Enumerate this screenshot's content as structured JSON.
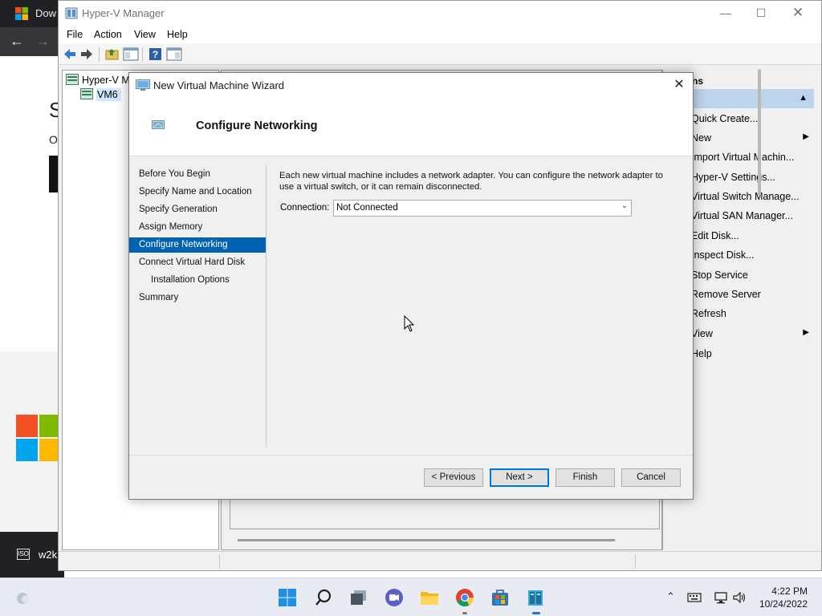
{
  "browser": {
    "tab_title": "Dow",
    "page_heading_fragment": "S",
    "page_text_fragment": "O",
    "download_item": "w2k",
    "download_icon_text": "ISO"
  },
  "hyperv": {
    "title": "Hyper-V Manager",
    "menu": [
      "File",
      "Action",
      "View",
      "Help"
    ],
    "tree_root": "Hyper-V M",
    "tree_child": "VM6",
    "actions_header": "ns",
    "actions": [
      {
        "label": "Quick Create...",
        "submenu": false
      },
      {
        "label": "New",
        "submenu": true
      },
      {
        "label": "Import Virtual Machin...",
        "submenu": false
      },
      {
        "label": "Hyper-V Settings...",
        "submenu": false
      },
      {
        "label": "Virtual Switch Manage...",
        "submenu": false
      },
      {
        "label": "Virtual SAN Manager...",
        "submenu": false
      },
      {
        "label": "Edit Disk...",
        "submenu": false
      },
      {
        "label": "Inspect Disk...",
        "submenu": false
      },
      {
        "label": "Stop Service",
        "submenu": false
      },
      {
        "label": "Remove Server",
        "submenu": false
      },
      {
        "label": "Refresh",
        "submenu": false
      },
      {
        "label": "View",
        "submenu": true
      },
      {
        "label": "Help",
        "submenu": false
      }
    ]
  },
  "wizard": {
    "title": "New Virtual Machine Wizard",
    "page_title": "Configure Networking",
    "steps": [
      {
        "label": "Before You Begin",
        "active": false,
        "sub": false
      },
      {
        "label": "Specify Name and Location",
        "active": false,
        "sub": false
      },
      {
        "label": "Specify Generation",
        "active": false,
        "sub": false
      },
      {
        "label": "Assign Memory",
        "active": false,
        "sub": false
      },
      {
        "label": "Configure Networking",
        "active": true,
        "sub": false
      },
      {
        "label": "Connect Virtual Hard Disk",
        "active": false,
        "sub": false
      },
      {
        "label": "Installation Options",
        "active": false,
        "sub": true
      },
      {
        "label": "Summary",
        "active": false,
        "sub": false
      }
    ],
    "description": "Each new virtual machine includes a network adapter. You can configure the network adapter to use a virtual switch, or it can remain disconnected.",
    "connection_label": "Connection:",
    "connection_value": "Not Connected",
    "buttons": {
      "previous": "< Previous",
      "next": "Next >",
      "finish": "Finish",
      "cancel": "Cancel"
    }
  },
  "taskbar": {
    "time": "4:22 PM",
    "date": "10/24/2022",
    "icons": [
      "start-icon",
      "search-icon",
      "task-view-icon",
      "meet-icon",
      "file-explorer-icon",
      "chrome-icon",
      "store-icon",
      "hyperv-manager-icon"
    ]
  },
  "colors": {
    "accent": "#0063b1",
    "selection": "#cde8ff",
    "actions_group": "#bcd4ec"
  }
}
